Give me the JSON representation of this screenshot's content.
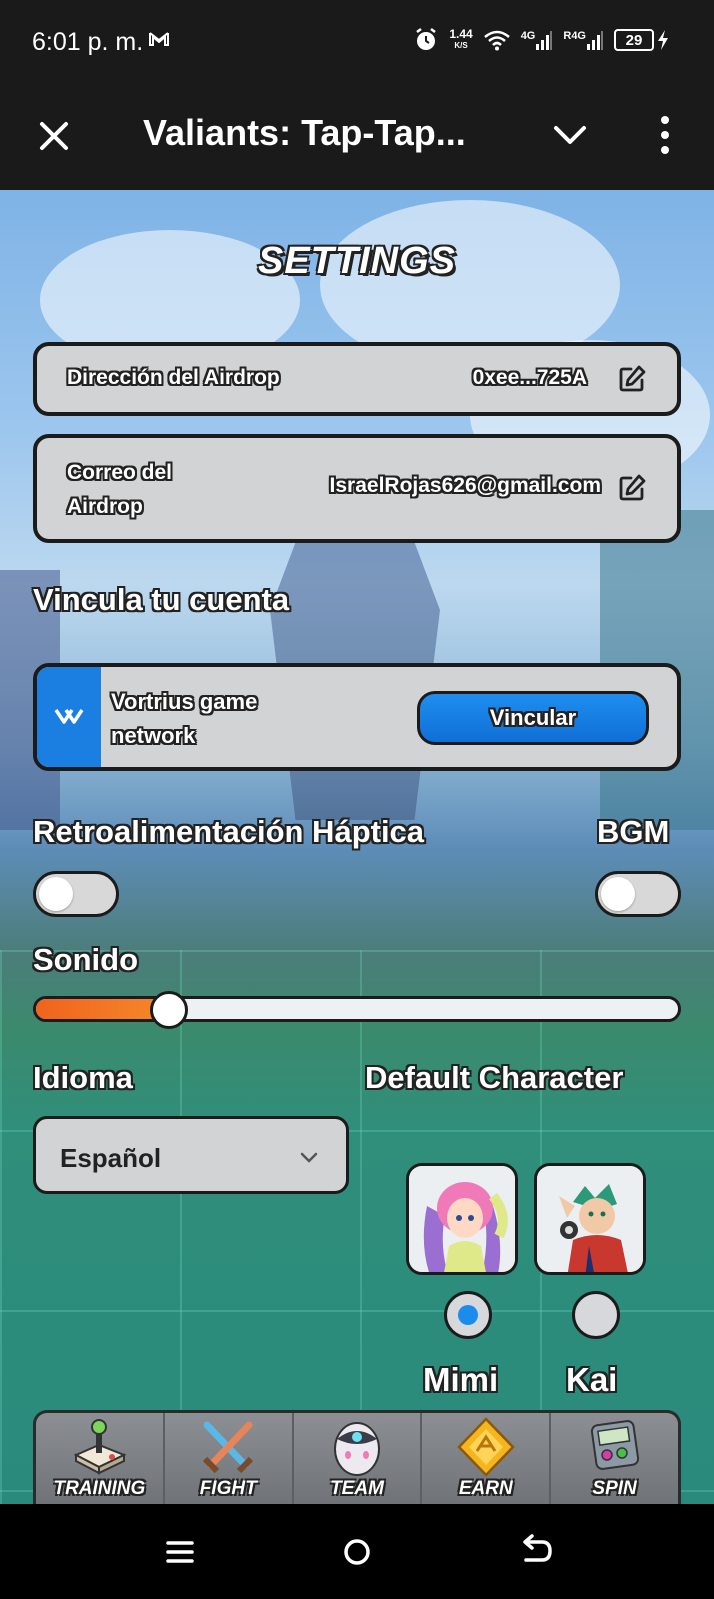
{
  "status_bar": {
    "time": "6:01 p. m.",
    "net_speed": "1.44",
    "net_speed_unit": "K/S",
    "sim1": "4G",
    "sim2": "R4G",
    "battery": "29"
  },
  "app_header": {
    "title": "Valiants: Tap-Tap..."
  },
  "settings": {
    "title": "SETTINGS",
    "airdrop_address_label": "Dirección del Airdrop",
    "airdrop_address_value": "0xee...725A",
    "airdrop_email_label": "Correo del Airdrop",
    "airdrop_email_value": "IsraelRojas626@gmail.com",
    "link_section_label": "Vincula tu cuenta",
    "link_provider_name": "Vortrius game network",
    "link_button_label": "Vincular",
    "haptic_label": "Retroalimentación Háptica",
    "haptic_on": false,
    "bgm_label": "BGM",
    "bgm_on": false,
    "sound_label": "Sonido",
    "sound_level": 0.21,
    "language_label": "Idioma",
    "language_value": "Español",
    "default_character_label": "Default Character",
    "characters": [
      {
        "name": "Mimi",
        "selected": true
      },
      {
        "name": "Kai",
        "selected": false
      }
    ]
  },
  "bottom_nav": {
    "items": [
      {
        "label": "TRAINING",
        "icon": "joystick-icon"
      },
      {
        "label": "FIGHT",
        "icon": "crossed-swords-icon"
      },
      {
        "label": "TEAM",
        "icon": "robot-egg-icon"
      },
      {
        "label": "EARN",
        "icon": "gold-gem-icon"
      },
      {
        "label": "SPIN",
        "icon": "slot-machine-icon"
      }
    ]
  },
  "colors": {
    "accent_blue": "#1a7fe0",
    "slider_orange": "#f0631d",
    "card_gray": "#d2d3d5"
  }
}
